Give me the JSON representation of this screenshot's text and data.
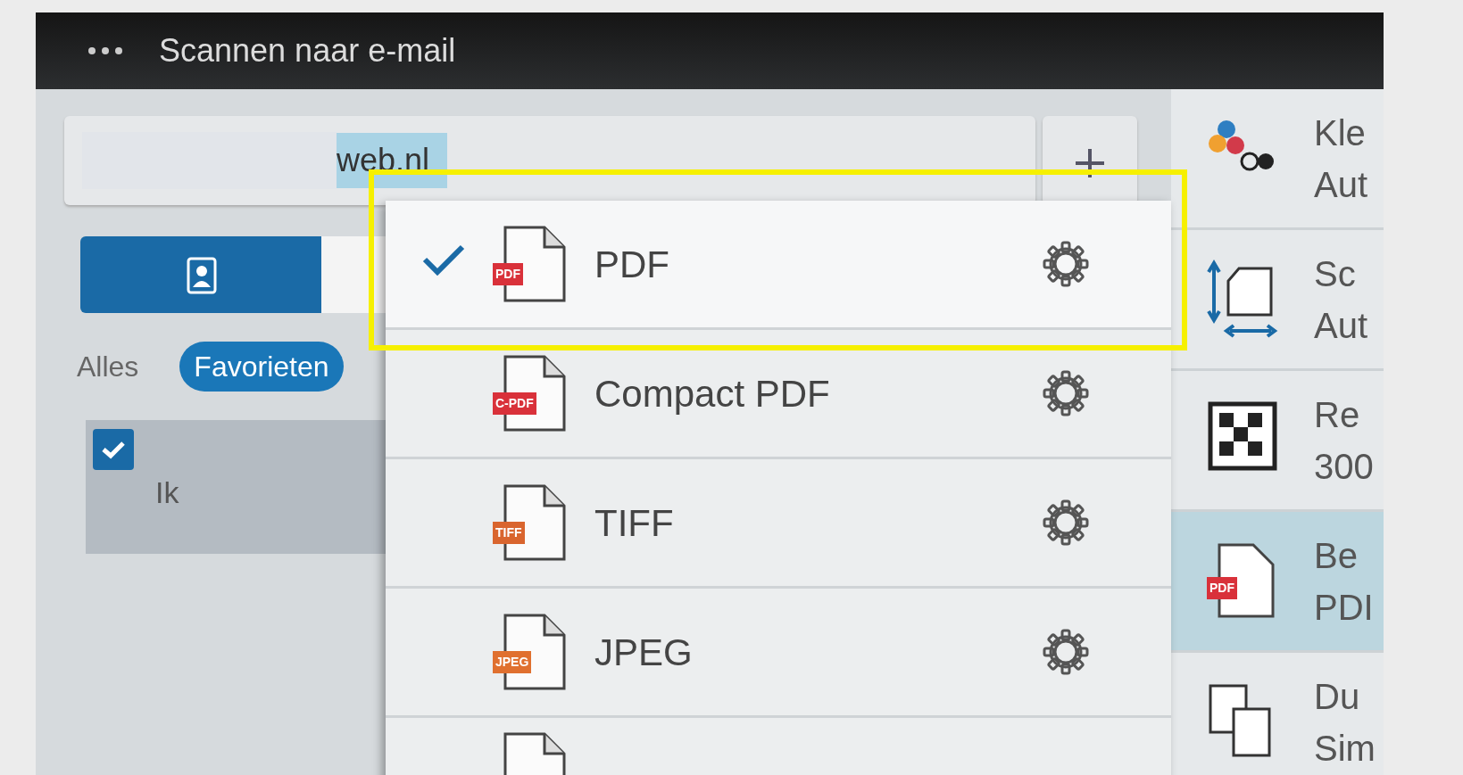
{
  "title_bar": {
    "title": "Scannen naar e-mail"
  },
  "recipient": {
    "value": "web.nl"
  },
  "source_toggle": [
    {
      "kind": "contacts",
      "selected": true
    },
    {
      "kind": "manual",
      "selected": false
    }
  ],
  "filter_tabs": [
    {
      "label": "Alles",
      "selected": false
    },
    {
      "label": "Favorieten",
      "selected": true
    }
  ],
  "contacts": [
    {
      "name": "Ik",
      "checked": true
    }
  ],
  "format_menu": [
    {
      "label": "PDF",
      "badge": "PDF",
      "color": "#d9313a",
      "selected": true
    },
    {
      "label": "Compact PDF",
      "badge": "C-PDF",
      "color": "#d9313a",
      "selected": false
    },
    {
      "label": "TIFF",
      "badge": "TIFF",
      "color": "#d9652e",
      "selected": false
    },
    {
      "label": "JPEG",
      "badge": "JPEG",
      "color": "#e0702f",
      "selected": false
    }
  ],
  "settings": [
    {
      "kind": "color",
      "label": "Kle",
      "value": "Aut",
      "selected": false
    },
    {
      "kind": "size",
      "label": "Sc",
      "value": "Aut",
      "selected": false
    },
    {
      "kind": "resolution",
      "label": "Re",
      "value": "300",
      "selected": false
    },
    {
      "kind": "format",
      "label": "Be",
      "value": "PDI",
      "badge": "PDF",
      "selected": true
    },
    {
      "kind": "duplex",
      "label": "Du",
      "value": "Sim",
      "selected": false
    }
  ]
}
